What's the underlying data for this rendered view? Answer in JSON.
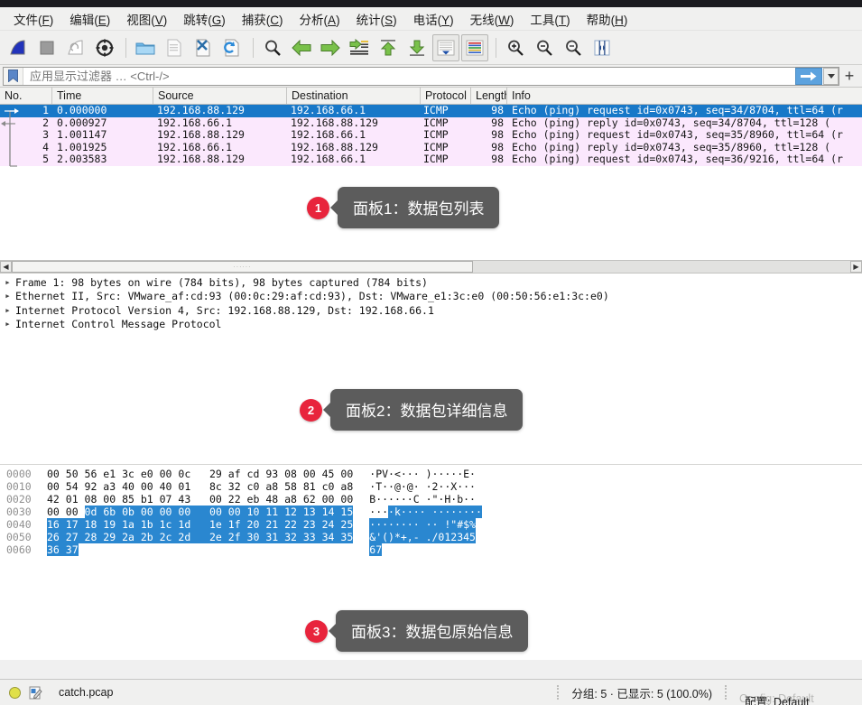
{
  "window": {
    "app": "Wireshark"
  },
  "menubar": {
    "items": [
      {
        "label": "文件",
        "accel": "F"
      },
      {
        "label": "编辑",
        "accel": "E"
      },
      {
        "label": "视图",
        "accel": "V"
      },
      {
        "label": "跳转",
        "accel": "G"
      },
      {
        "label": "捕获",
        "accel": "C"
      },
      {
        "label": "分析",
        "accel": "A"
      },
      {
        "label": "统计",
        "accel": "S"
      },
      {
        "label": "电话",
        "accel": "Y"
      },
      {
        "label": "无线",
        "accel": "W"
      },
      {
        "label": "工具",
        "accel": "T"
      },
      {
        "label": "帮助",
        "accel": "H"
      }
    ]
  },
  "toolbar": {
    "buttons": [
      {
        "name": "start-capture-icon"
      },
      {
        "name": "stop-capture-icon"
      },
      {
        "name": "restart-capture-icon"
      },
      {
        "name": "capture-options-icon"
      },
      {
        "name": "separator"
      },
      {
        "name": "open-file-icon"
      },
      {
        "name": "save-file-icon"
      },
      {
        "name": "close-file-icon"
      },
      {
        "name": "reload-file-icon"
      },
      {
        "name": "separator"
      },
      {
        "name": "find-packet-icon"
      },
      {
        "name": "go-back-icon"
      },
      {
        "name": "go-forward-icon"
      },
      {
        "name": "go-to-packet-icon"
      },
      {
        "name": "go-to-first-icon"
      },
      {
        "name": "go-to-last-icon"
      },
      {
        "name": "auto-scroll-icon"
      },
      {
        "name": "colorize-icon"
      },
      {
        "name": "separator"
      },
      {
        "name": "zoom-in-icon"
      },
      {
        "name": "zoom-out-icon"
      },
      {
        "name": "zoom-reset-icon"
      },
      {
        "name": "resize-columns-icon"
      }
    ]
  },
  "filter": {
    "placeholder": "应用显示过滤器 … <Ctrl-/>",
    "value": "",
    "bookmark_icon": "bookmark-icon",
    "apply_icon": "apply-filter-arrow-icon",
    "dropdown_icon": "chevron-down-icon",
    "add_icon": "add-filter-button"
  },
  "packet_list": {
    "columns": [
      {
        "label": "No."
      },
      {
        "label": "Time"
      },
      {
        "label": "Source"
      },
      {
        "label": "Destination"
      },
      {
        "label": "Protocol"
      },
      {
        "label": "Length"
      },
      {
        "label": "Info"
      }
    ],
    "rows": [
      {
        "no": "1",
        "time": "0.000000",
        "source": "192.168.88.129",
        "destination": "192.168.66.1",
        "protocol": "ICMP",
        "length": "98",
        "info": "Echo (ping) request  id=0x0743, seq=34/8704, ttl=64 (r",
        "selected": true
      },
      {
        "no": "2",
        "time": "0.000927",
        "source": "192.168.66.1",
        "destination": "192.168.88.129",
        "protocol": "ICMP",
        "length": "98",
        "info": "Echo (ping) reply    id=0x0743, seq=34/8704, ttl=128 (",
        "selected": false
      },
      {
        "no": "3",
        "time": "1.001147",
        "source": "192.168.88.129",
        "destination": "192.168.66.1",
        "protocol": "ICMP",
        "length": "98",
        "info": "Echo (ping) request  id=0x0743, seq=35/8960, ttl=64 (r",
        "selected": false
      },
      {
        "no": "4",
        "time": "1.001925",
        "source": "192.168.66.1",
        "destination": "192.168.88.129",
        "protocol": "ICMP",
        "length": "98",
        "info": "Echo (ping) reply    id=0x0743, seq=35/8960, ttl=128 (",
        "selected": false
      },
      {
        "no": "5",
        "time": "2.003583",
        "source": "192.168.88.129",
        "destination": "192.168.66.1",
        "protocol": "ICMP",
        "length": "98",
        "info": "Echo (ping) request  id=0x0743, seq=36/9216, ttl=64 (r",
        "selected": false
      }
    ]
  },
  "packet_details": {
    "rows": [
      "Frame 1: 98 bytes on wire (784 bits), 98 bytes captured (784 bits)",
      "Ethernet II, Src: VMware_af:cd:93 (00:0c:29:af:cd:93), Dst: VMware_e1:3c:e0 (00:50:56:e1:3c:e0)",
      "Internet Protocol Version 4, Src: 192.168.88.129, Dst: 192.168.66.1",
      "Internet Control Message Protocol"
    ]
  },
  "packet_bytes": {
    "rows": [
      {
        "offset": "0000",
        "hex_plain": "00 50 56 e1 3c e0 00 0c   29 af cd 93 08 00 45 00",
        "hex_hl": "",
        "ascii_plain": "·PV·<··· )·····E·",
        "ascii_hl": ""
      },
      {
        "offset": "0010",
        "hex_plain": "00 54 92 a3 40 00 40 01   8c 32 c0 a8 58 81 c0 a8",
        "hex_hl": "",
        "ascii_plain": "·T··@·@· ·2··X···",
        "ascii_hl": ""
      },
      {
        "offset": "0020",
        "hex_plain": "42 01 08 00 85 b1 07 43   00 22 eb 48 a8 62 00 00",
        "hex_hl": "",
        "ascii_plain": "B······C ·\"·H·b··",
        "ascii_hl": ""
      },
      {
        "offset": "0030",
        "hex_plain": "00 00 ",
        "hex_hl": "0d 6b 0b 00 00 00   00 00 10 11 12 13 14 15",
        "ascii_plain": "···",
        "ascii_hl": "·k···· ········"
      },
      {
        "offset": "0040",
        "hex_plain": "",
        "hex_hl": "16 17 18 19 1a 1b 1c 1d   1e 1f 20 21 22 23 24 25",
        "ascii_plain": "",
        "ascii_hl": "········ ·· !\"#$%"
      },
      {
        "offset": "0050",
        "hex_plain": "",
        "hex_hl": "26 27 28 29 2a 2b 2c 2d   2e 2f 30 31 32 33 34 35",
        "ascii_plain": "",
        "ascii_hl": "&'()*+,- ./012345"
      },
      {
        "offset": "0060",
        "hex_plain": "",
        "hex_hl": "36 37",
        "ascii_plain": "",
        "ascii_hl": "67"
      }
    ]
  },
  "callouts": [
    {
      "number": "1",
      "text": "面板1：数据包列表"
    },
    {
      "number": "2",
      "text": "面板2：数据包详细信息"
    },
    {
      "number": "3",
      "text": "面板3：数据包原始信息"
    }
  ],
  "statusbar": {
    "expert_icon": "expert-info-icon",
    "file": "catch.pcap",
    "packets": "分组: 5 · 已显示: 5 (100.0%)",
    "profile": "配置: Default",
    "profile_ghost": "Config: Default"
  },
  "colors": {
    "selection_blue": "#1878c8",
    "icmp_row": "#fbe8fd",
    "callout_red": "#e8243c",
    "callout_grey": "#5c5c5c",
    "hex_highlight": "#2a87d0"
  }
}
